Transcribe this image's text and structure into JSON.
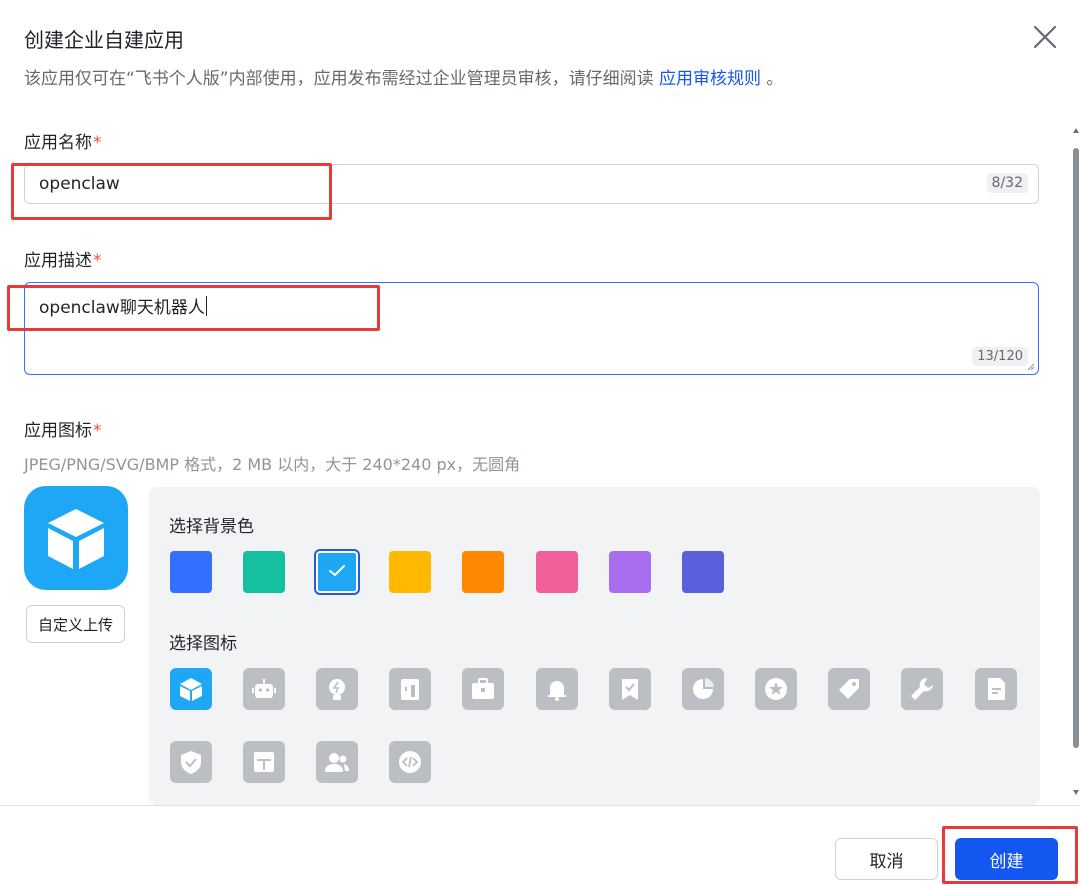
{
  "dialog": {
    "title": "创建企业自建应用",
    "subtitle_text": "该应用仅可在“飞书个人版”内部使用，应用发布需经过企业管理员审核，请仔细阅读",
    "subtitle_link": "应用审核规则",
    "subtitle_end": " 。"
  },
  "name_field": {
    "label": "应用名称",
    "required_mark": "*",
    "value": "openclaw",
    "count": "8/32"
  },
  "desc_field": {
    "label": "应用描述",
    "required_mark": "*",
    "value": "openclaw聊天机器人",
    "count": "13/120"
  },
  "icon_field": {
    "label": "应用图标",
    "required_mark": "*",
    "hint": "JPEG/PNG/SVG/BMP 格式，2 MB 以内，大于 240*240 px，无圆角",
    "upload_label": "自定义上传",
    "preview_icon": "cube-icon",
    "preview_color": "#1ea7f5"
  },
  "picker": {
    "bg_label": "选择背景色",
    "icon_label": "选择图标",
    "colors": [
      "#3370ff",
      "#14c0a0",
      "#1ea7f5",
      "#ffba00",
      "#ff8800",
      "#f0609a",
      "#a86ef0",
      "#5b5fdb"
    ],
    "selected_color_index": 2,
    "icons": [
      "cube-icon",
      "robot-icon",
      "lightbulb-icon",
      "door-icon",
      "briefcase-icon",
      "bell-icon",
      "bookmark-check-icon",
      "pie-chart-icon",
      "star-icon",
      "tag-icon",
      "wrench-icon",
      "document-icon",
      "shield-check-icon",
      "layout-icon",
      "users-icon",
      "code-icon"
    ],
    "selected_icon_index": 0
  },
  "footer": {
    "cancel_label": "取消",
    "create_label": "创建"
  }
}
